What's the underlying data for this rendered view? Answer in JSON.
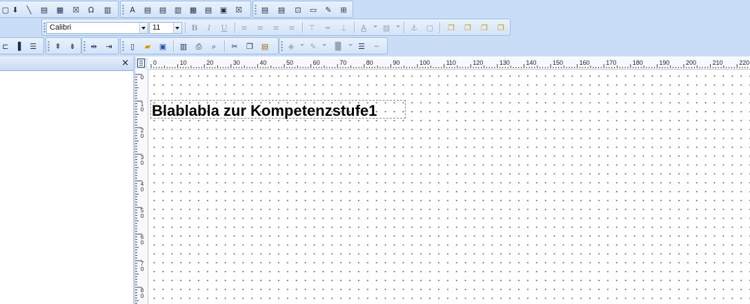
{
  "format_toolbar": {
    "font_name": "Calibri",
    "font_size": "11"
  },
  "ruler": {
    "horizontal_labels": [
      "0",
      "10",
      "20",
      "30",
      "40",
      "50",
      "60",
      "70",
      "80",
      "90",
      "100",
      "110",
      "120",
      "130",
      "140",
      "150",
      "160",
      "170",
      "180",
      "190",
      "200",
      "210",
      "220"
    ],
    "vertical_labels": [
      [
        "0"
      ],
      [
        "1",
        "0"
      ],
      [
        "2",
        "0"
      ],
      [
        "3",
        "0"
      ],
      [
        "4",
        "0"
      ],
      [
        "5",
        "0"
      ],
      [
        "6",
        "0"
      ],
      [
        "7",
        "0"
      ],
      [
        "8",
        "0"
      ]
    ]
  },
  "canvas": {
    "text_field_value": "Blablabla zur Kompetenzstufe1"
  },
  "left_panel": {
    "close_glyph": "×"
  },
  "icons": [
    "line-tool-icon",
    "text-field-icon",
    "checkbox-icon",
    "table-icon",
    "bold-icon",
    "italic-icon",
    "underline-icon",
    "align-left-icon",
    "align-center-icon",
    "align-right-icon",
    "justify-icon",
    "new-icon",
    "open-icon",
    "save-icon",
    "print-icon",
    "preview-icon",
    "cut-icon",
    "copy-icon",
    "paste-icon"
  ]
}
